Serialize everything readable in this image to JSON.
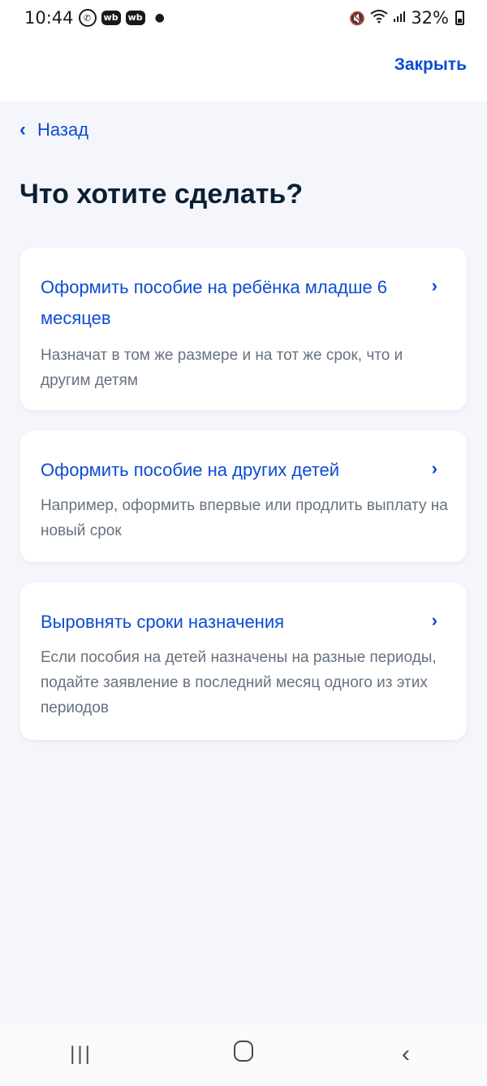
{
  "status_bar": {
    "time": "10:44",
    "wb1": "wb",
    "wb2": "wb",
    "battery": "32%",
    "icons": [
      "viber-icon",
      "wb-app-icon",
      "wb-app-icon",
      "dot-icon",
      "mute-icon",
      "wifi-icon",
      "signal-icon",
      "battery-icon"
    ]
  },
  "header": {
    "close_label": "Закрыть"
  },
  "back": {
    "label": "Назад"
  },
  "page": {
    "title": "Что хотите сделать?"
  },
  "options": [
    {
      "title": "Оформить пособие на ребёнка младше 6 месяцев",
      "description": "Назначат в том же размере и на тот же срок, что и другим детям"
    },
    {
      "title": "Оформить пособие на других детей",
      "description": "Например, оформить впервые или продлить выплату на новый срок"
    },
    {
      "title": "Выровнять сроки назначения",
      "description": "Если пособия на детей назначены на разные периоды, подайте заявление в последний месяц одного из этих периодов"
    }
  ],
  "colors": {
    "accent": "#0d4cd3",
    "background": "#f4f6fb",
    "text_primary": "#0b1f33",
    "text_secondary": "#66727f"
  }
}
